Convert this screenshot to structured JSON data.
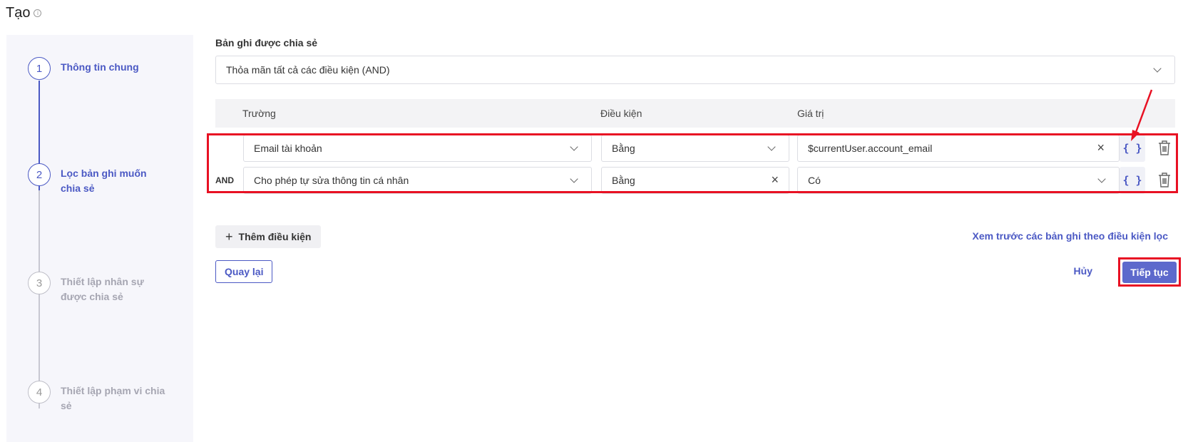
{
  "page": {
    "title": "Tạo",
    "info_icon": "info-icon"
  },
  "stepper": {
    "steps": [
      {
        "number": "1",
        "label": "Thông tin chung",
        "state": "done"
      },
      {
        "number": "2",
        "label": "Lọc bản ghi muốn chia sẻ",
        "state": "active"
      },
      {
        "number": "3",
        "label": "Thiết lập nhân sự được chia sẻ",
        "state": "pending"
      },
      {
        "number": "4",
        "label": "Thiết lập phạm vi chia sẻ",
        "state": "pending"
      }
    ]
  },
  "filter": {
    "section_label": "Bản ghi được chia sẻ",
    "logic_value": "Thỏa mãn tất cả các điều kiện (AND)",
    "columns": {
      "field": "Trường",
      "condition": "Điều kiện",
      "value": "Giá trị"
    },
    "rows": [
      {
        "conjunction": "",
        "field": "Email tài khoản",
        "condition": "Bằng",
        "value": "$currentUser.account_email",
        "variable_icon": "{ }"
      },
      {
        "conjunction": "AND",
        "field": "Cho phép tự sửa thông tin cá nhân",
        "condition": "Bằng",
        "value": "Có",
        "variable_icon": "{ }"
      }
    ],
    "add_condition_label": "Thêm điều kiện",
    "preview_link": "Xem trước các bản ghi theo điều kiện lọc"
  },
  "footer": {
    "back_label": "Quay lại",
    "cancel_label": "Hủy",
    "next_label": "Tiếp tục"
  },
  "colors": {
    "accent": "#4b59c4",
    "primary_button": "#5d69cc",
    "highlight": "#e81123"
  }
}
